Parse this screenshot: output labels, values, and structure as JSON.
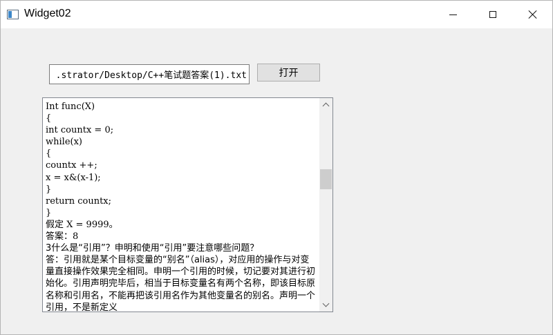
{
  "window": {
    "title": "Widget02",
    "icon": "app-window-icon",
    "controls": [
      "minimize-icon",
      "maximize-icon",
      "close-icon"
    ]
  },
  "file_path": {
    "value": ".strator/Desktop/C++笔试题答案(1).txt"
  },
  "open_button": {
    "label": "打开"
  },
  "editor": {
    "code_lines": [
      "Int func(X)",
      " {",
      "int countx = 0;",
      "while(x)",
      " {",
      "countx ++;",
      "x = x&(x-1);",
      " }",
      "return countx;",
      " }",
      "假定 X = 9999。",
      "答案：8"
    ],
    "question": "3什么是“引用”？申明和使用“引用”要注意哪些问题？",
    "answer": "答：引用就是某个目标变量的“别名”（alias），对应用的操作与对变量直接操作效果完全相同。申明一个引用的时候，切记要对其进行初始化。引用声明完毕后，相当于目标变量名有两个名称，即该目标原名称和引用名，不能再把该引用名作为其他变量名的别名。声明一个引用，不是新定义"
  }
}
